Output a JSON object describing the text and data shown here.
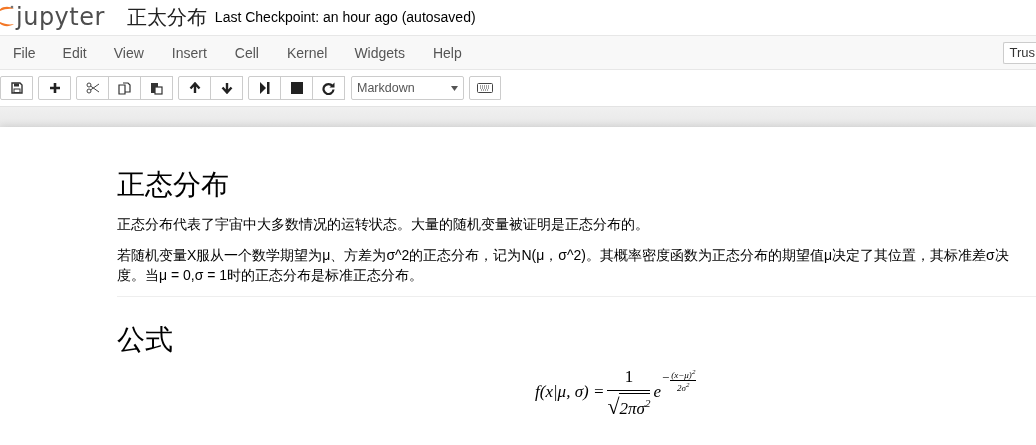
{
  "header": {
    "logo_text": "jupyter",
    "notebook_title": "正太分布",
    "checkpoint": "Last Checkpoint: an hour ago (autosaved)"
  },
  "menu": {
    "items": [
      "File",
      "Edit",
      "View",
      "Insert",
      "Cell",
      "Kernel",
      "Widgets",
      "Help"
    ],
    "trust_button": "Trus"
  },
  "toolbar": {
    "groups": [
      [
        {
          "kind": "save"
        }
      ],
      [
        {
          "kind": "add"
        }
      ],
      [
        {
          "kind": "cut"
        },
        {
          "kind": "copy"
        },
        {
          "kind": "paste"
        }
      ],
      [
        {
          "kind": "up"
        },
        {
          "kind": "down"
        }
      ],
      [
        {
          "kind": "run"
        },
        {
          "kind": "stop"
        },
        {
          "kind": "restart"
        }
      ],
      [
        {
          "kind": "select",
          "value": "Markdown"
        }
      ],
      [
        {
          "kind": "keyboard"
        }
      ]
    ]
  },
  "cells": [
    {
      "kind": "h1",
      "text": "正态分布"
    },
    {
      "kind": "p",
      "text": "正态分布代表了宇宙中大多数情况的运转状态。大量的随机变量被证明是正态分布的。"
    },
    {
      "kind": "lines",
      "lines": [
        "若随机变量X服从一个数学期望为μ、方差为σ^2的正态分布，记为N(μ，σ^2)。其概率密度函数为正态分布的期望值μ决定了其位置，其标准差σ决",
        "度。当μ = 0,σ = 1时的正态分布是标准正态分布。"
      ]
    },
    {
      "kind": "hr"
    },
    {
      "kind": "h1",
      "text": "公式"
    },
    {
      "kind": "formula",
      "lhs": "f(x|μ, σ) =",
      "numerator": "1",
      "sqrt_sign": "√",
      "radicand": "2πσ$^{2}$",
      "base": "e",
      "exp_sign": "−",
      "exp_numerator": "(x−μ)$^{2}$",
      "exp_denominator": "2σ$^{2}$"
    }
  ]
}
